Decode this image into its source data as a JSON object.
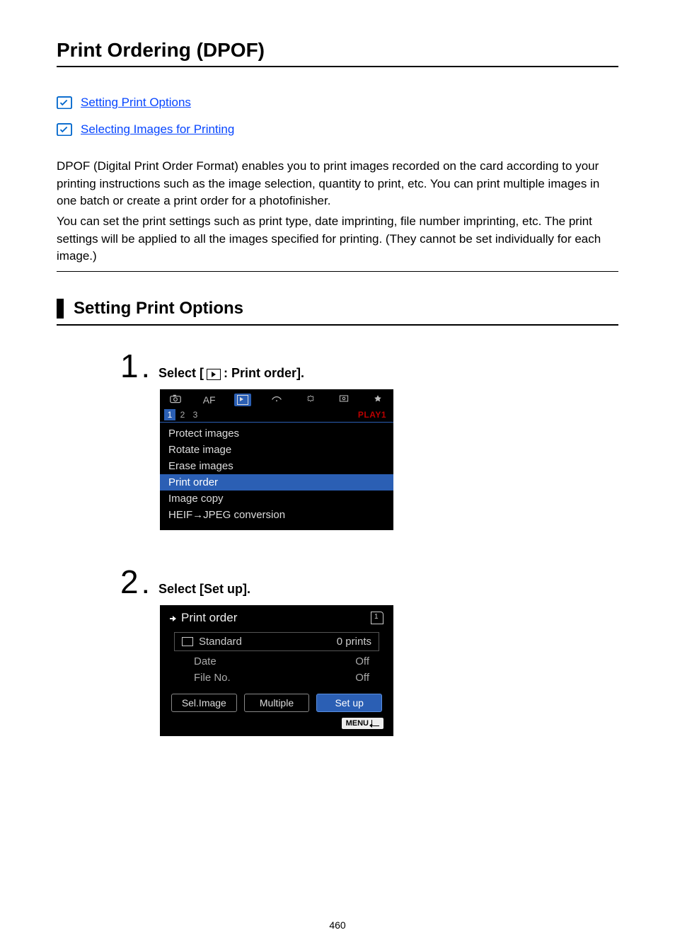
{
  "page_title": "Print Ordering (DPOF)",
  "toc": {
    "link1": "Setting Print Options",
    "link2": "Selecting Images for Printing"
  },
  "intro": {
    "p1": "DPOF (Digital Print Order Format) enables you to print images recorded on the card according to your printing instructions such as the image selection, quantity to print, etc. You can print multiple images in one batch or create a print order for a photofinisher.",
    "p2": "You can set the print settings such as print type, date imprinting, file number imprinting, etc. The print settings will be applied to all the images specified for printing. (They cannot be set individually for each image.)"
  },
  "section_heading": "Setting Print Options",
  "steps": {
    "s1": {
      "num": "1",
      "title_pre": "Select [",
      "title_post": ": Print order].",
      "screen": {
        "top_icons": {
          "camera": "camera-icon",
          "af": "AF",
          "play": "play-icon",
          "wifi": "wifi-icon",
          "power": "power-icon",
          "tool": "tool-icon",
          "star": "star-icon"
        },
        "sub_nums": [
          "1",
          "2",
          "3"
        ],
        "sub_label": "PLAY1",
        "menu": [
          "Protect images",
          "Rotate image",
          "Erase images",
          "Print order",
          "Image copy",
          "HEIF→JPEG conversion"
        ],
        "selected_index": 3
      }
    },
    "s2": {
      "num": "2",
      "title": "Select [Set up].",
      "screen": {
        "header_left": "Print order",
        "row_standard_label": "Standard",
        "row_standard_value": "0 prints",
        "date_label": "Date",
        "date_value": "Off",
        "fileno_label": "File No.",
        "fileno_value": "Off",
        "buttons": [
          "Sel.Image",
          "Multiple",
          "Set up"
        ],
        "highlight_index": 2,
        "menu_label": "MENU"
      }
    }
  },
  "page_number": "460"
}
